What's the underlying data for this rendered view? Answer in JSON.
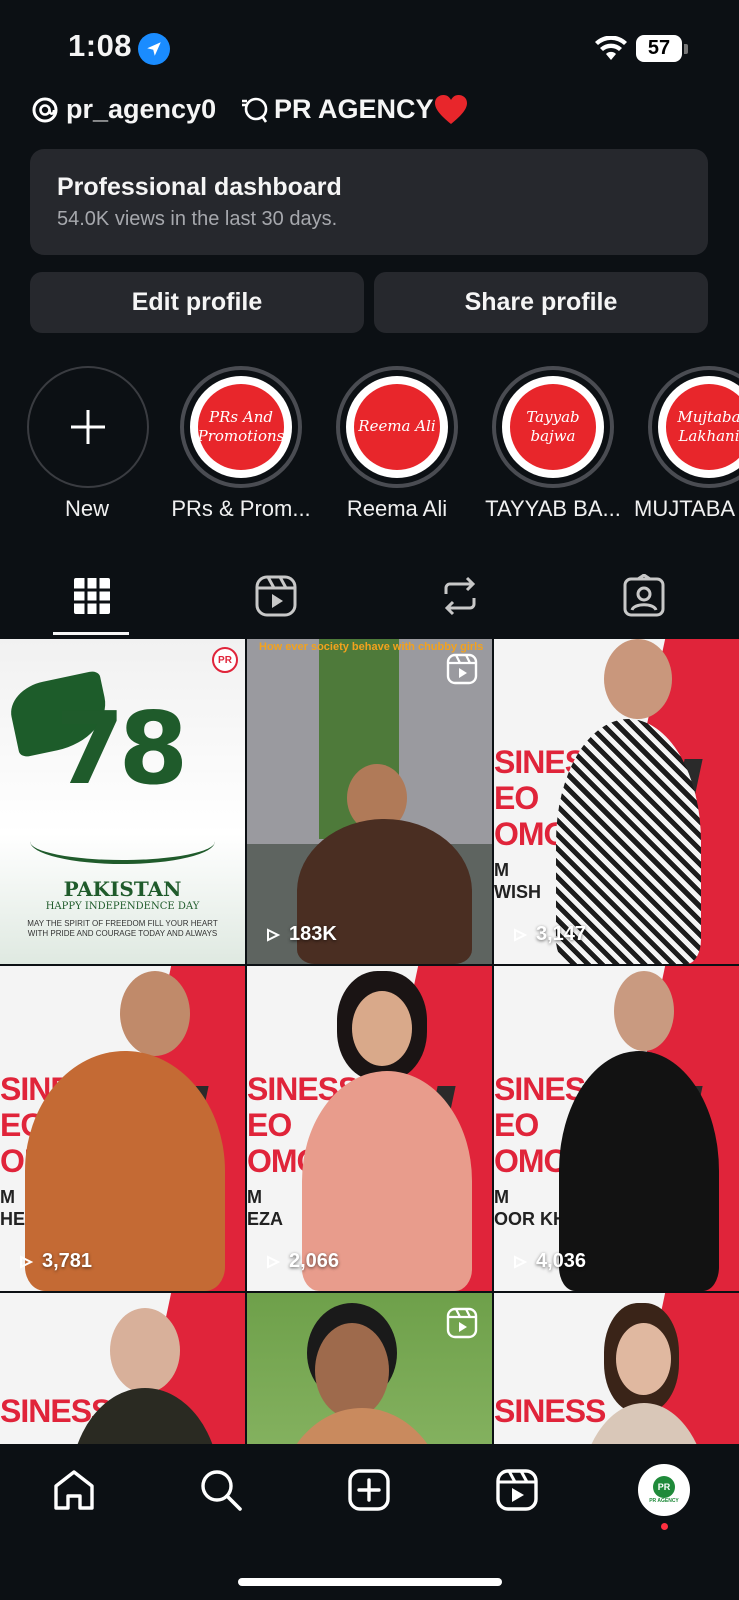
{
  "status_bar": {
    "time": "1:08",
    "battery": "57"
  },
  "account": {
    "handle": "pr_agency0",
    "display_name": "PR AGENCY"
  },
  "dashboard": {
    "title": "Professional dashboard",
    "subtitle": "54.0K views in the last 30 days."
  },
  "buttons": {
    "edit": "Edit profile",
    "share": "Share profile"
  },
  "highlights": [
    {
      "label": "New",
      "cover": ""
    },
    {
      "label": "PRs & Prom...",
      "cover": "PRs And Promotions"
    },
    {
      "label": "Reema Ali",
      "cover": "Reema Ali"
    },
    {
      "label": "TAYYAB BA...",
      "cover": "Tayyab bajwa"
    },
    {
      "label": "MUJTABA",
      "cover": "Mujtaba Lakhani"
    }
  ],
  "tabs": [
    "grid-icon",
    "reels-icon",
    "reposts-icon",
    "tagged-icon"
  ],
  "posts": [
    {
      "views": "",
      "caption_top": "",
      "caption_bottom": "PAKISTAN",
      "caption_sub": "HAPPY INDEPENDENCE DAY",
      "caption_line": "MAY THE SPIRIT OF FREEDOM FILL YOUR HEART WITH PRIDE AND COURAGE TODAY AND ALWAYS",
      "badge_num": "78"
    },
    {
      "views": "183K",
      "caption_top": "How ever society behave with chubby girls"
    },
    {
      "views": "3,147",
      "promo_text": "SINESS\nEO\nOMOTION",
      "name_text": "M\nWISH"
    },
    {
      "views": "3,781",
      "promo_text": "SINESS\nEO\nOMC",
      "name_text": "M\nHEED"
    },
    {
      "views": "2,066",
      "promo_text": "SINESS\nEO\nOMOTI",
      "name_text": "M\nEZA"
    },
    {
      "views": "4,036",
      "promo_text": "SINESS\nEO\nOMOTIO",
      "name_text": "M\nOOR KHAN"
    },
    {
      "views": "",
      "promo_text": "SINESS"
    },
    {
      "views": ""
    },
    {
      "views": "",
      "promo_text": "SINESS"
    }
  ],
  "pr_logo_text": "PR AGENCY",
  "colors": {
    "background": "#0c1014",
    "card": "#26282d",
    "accent_red": "#e0243a",
    "location_blue": "#1a8cff"
  }
}
